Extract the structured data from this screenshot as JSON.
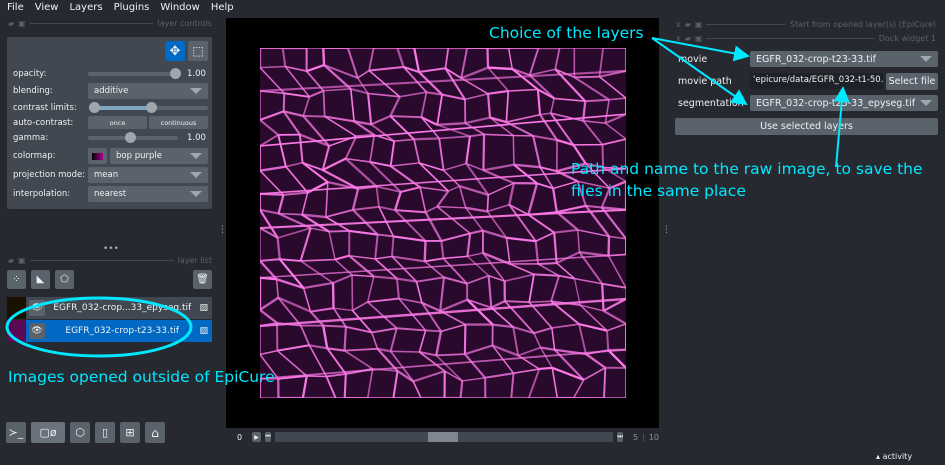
{
  "menu": [
    "File",
    "View",
    "Layers",
    "Plugins",
    "Window",
    "Help"
  ],
  "layer_controls": {
    "title": "layer controls",
    "opacity_label": "opacity:",
    "opacity": 1.0,
    "opacity_text": "1.00",
    "blending_label": "blending:",
    "blending": "additive",
    "contrast_label": "contrast limits:",
    "contrast_range": [
      0,
      0.5
    ],
    "autocontrast_label": "auto-contrast:",
    "once": "once",
    "continuous": "continuous",
    "gamma_label": "gamma:",
    "gamma_text": "1.00",
    "colormap_label": "colormap:",
    "colormap": "bop purple",
    "projection_label": "projection mode:",
    "projection": "mean",
    "interp_label": "interpolation:",
    "interp": "nearest"
  },
  "layer_list": {
    "title": "layer list",
    "layers": [
      {
        "name": "EGFR_032-crop...33_epyseg.tif",
        "selected": false
      },
      {
        "name": "EGFR_032-crop-t23-33.tif",
        "selected": true
      }
    ]
  },
  "dims": {
    "start": "0",
    "current": "5",
    "total": "10"
  },
  "status": {
    "activity": "activity"
  },
  "dock": {
    "title1": "Start from opened layer(s) (EpiCure)",
    "title2": "Dock widget 1",
    "movie_label": "movie",
    "movie": "EGFR_032-crop-t23-33.tif",
    "path_label": "movie path",
    "path": "'epicure/data/EGFR_032-t1-50.tif",
    "select_file": "Select file",
    "seg_label": "segmentation",
    "seg": "EGFR_032-crop-t23-33_epyseg.tif",
    "use_button": "Use selected layers"
  },
  "annotations": {
    "choice": "Choice of the layers",
    "path_note_1": "Path and name to the raw image, to save the",
    "path_note_2": "files in the same place",
    "outside": "Images opened outside of EpiCure",
    "color": "#00e8ff"
  },
  "colors": {
    "accent": "#0069c3",
    "panel": "#414851",
    "bg": "#262930",
    "cell_edge": "#ff7bea"
  }
}
